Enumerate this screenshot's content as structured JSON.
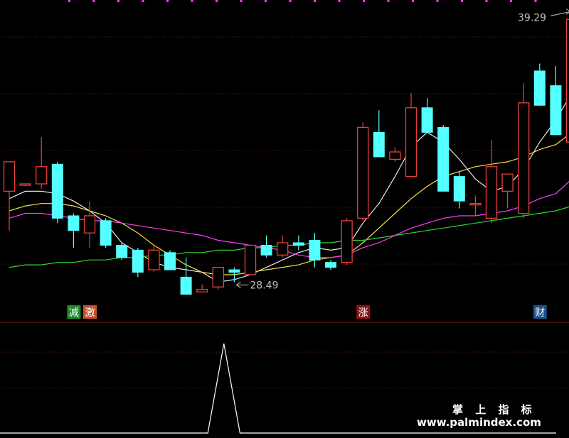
{
  "colors": {
    "background": "#000000",
    "up": "#e8413a",
    "down": "#54ffff",
    "grid": "#7a1a1a",
    "ma5": "#e8e8e8",
    "ma10": "#f2e24a",
    "ma20": "#ff3cff",
    "ma60": "#2ed82e",
    "indicator": "#ffffff",
    "annotation": "#c0c0c0",
    "top_dots": "#ff3cff"
  },
  "chart_data": [
    {
      "type": "candlestick",
      "title": "",
      "xlabel": "",
      "ylabel": "",
      "ylim": [
        27.6,
        39.6
      ],
      "grid": true,
      "candles": [
        {
          "o": 32.1,
          "h": 32.6,
          "l": 30.5,
          "c": 33.3
        },
        {
          "o": 32.4,
          "h": 32.3,
          "l": 32.3,
          "c": 32.4
        },
        {
          "o": 32.4,
          "h": 34.3,
          "l": 32.2,
          "c": 33.1
        },
        {
          "o": 33.2,
          "h": 33.3,
          "l": 30.8,
          "c": 31.0
        },
        {
          "o": 31.1,
          "h": 31.2,
          "l": 29.8,
          "c": 30.5
        },
        {
          "o": 30.4,
          "h": 31.7,
          "l": 29.8,
          "c": 31.1
        },
        {
          "o": 30.9,
          "h": 31.0,
          "l": 29.8,
          "c": 29.9
        },
        {
          "o": 29.9,
          "h": 30.0,
          "l": 29.3,
          "c": 29.4
        },
        {
          "o": 29.7,
          "h": 29.8,
          "l": 28.6,
          "c": 28.8
        },
        {
          "o": 28.9,
          "h": 29.9,
          "l": 28.8,
          "c": 29.7
        },
        {
          "o": 29.6,
          "h": 29.7,
          "l": 28.9,
          "c": 28.9
        },
        {
          "o": 28.6,
          "h": 29.4,
          "l": 28.2,
          "c": 27.9
        },
        {
          "o": 28.0,
          "h": 28.3,
          "l": 28.1,
          "c": 28.1
        },
        {
          "o": 28.2,
          "h": 28.9,
          "l": 28.1,
          "c": 29.0
        },
        {
          "o": 28.9,
          "h": 29.0,
          "l": 28.4,
          "c": 28.8
        },
        {
          "o": 28.7,
          "h": 29.9,
          "l": 28.7,
          "c": 29.9
        },
        {
          "o": 29.9,
          "h": 30.3,
          "l": 29.4,
          "c": 29.5
        },
        {
          "o": 29.5,
          "h": 30.3,
          "l": 29.4,
          "c": 30.0
        },
        {
          "o": 30.0,
          "h": 30.3,
          "l": 29.7,
          "c": 29.9
        },
        {
          "o": 30.1,
          "h": 30.4,
          "l": 29.0,
          "c": 29.3
        },
        {
          "o": 29.2,
          "h": 29.3,
          "l": 28.9,
          "c": 29.0
        },
        {
          "o": 29.2,
          "h": 31.0,
          "l": 29.1,
          "c": 30.9
        },
        {
          "o": 31.0,
          "h": 34.9,
          "l": 30.9,
          "c": 34.7
        },
        {
          "o": 34.5,
          "h": 35.4,
          "l": 33.6,
          "c": 33.5
        },
        {
          "o": 33.4,
          "h": 33.9,
          "l": 33.3,
          "c": 33.7
        },
        {
          "o": 32.7,
          "h": 36.1,
          "l": 32.7,
          "c": 35.5
        },
        {
          "o": 35.5,
          "h": 35.9,
          "l": 34.6,
          "c": 34.5
        },
        {
          "o": 34.7,
          "h": 34.8,
          "l": 32.1,
          "c": 32.1
        },
        {
          "o": 32.7,
          "h": 32.9,
          "l": 31.4,
          "c": 31.7
        },
        {
          "o": 31.6,
          "h": 31.9,
          "l": 31.1,
          "c": 31.6
        },
        {
          "o": 31.0,
          "h": 34.2,
          "l": 30.8,
          "c": 33.1
        },
        {
          "o": 32.1,
          "h": 32.8,
          "l": 31.4,
          "c": 32.8
        },
        {
          "o": 31.2,
          "h": 36.5,
          "l": 31.0,
          "c": 35.7
        },
        {
          "o": 37.0,
          "h": 37.3,
          "l": 36.0,
          "c": 35.6
        },
        {
          "o": 36.4,
          "h": 37.2,
          "l": 35.0,
          "c": 34.4
        },
        {
          "o": 34.1,
          "h": 39.3,
          "l": 33.8,
          "c": 39.1
        }
      ],
      "moving_averages": [
        {
          "name": "MA5",
          "color_key": "ma5",
          "values": [
            31.8,
            32.1,
            32.1,
            32.0,
            31.7,
            31.3,
            30.8,
            30.0,
            29.6,
            29.2,
            29.0,
            28.9,
            28.8,
            28.4,
            28.5,
            28.7,
            29.0,
            29.3,
            29.6,
            29.8,
            29.7,
            29.8,
            30.8,
            31.6,
            32.7,
            33.9,
            34.5,
            34.1,
            33.4,
            32.6,
            32.1,
            32.3,
            33.0,
            34.1,
            35.0,
            36.1
          ]
        },
        {
          "name": "MA10",
          "color_key": "ma10",
          "values": [
            31.3,
            31.5,
            31.6,
            31.6,
            31.5,
            31.3,
            31.1,
            30.8,
            30.4,
            29.9,
            29.5,
            29.1,
            28.8,
            28.7,
            28.7,
            28.8,
            28.9,
            29.0,
            29.1,
            29.3,
            29.4,
            29.5,
            30.0,
            30.6,
            31.2,
            31.8,
            32.3,
            32.7,
            32.9,
            33.1,
            33.2,
            33.3,
            33.5,
            33.8,
            34.0,
            34.5
          ]
        },
        {
          "name": "MA20",
          "color_key": "ma20",
          "values": [
            31.0,
            31.2,
            31.2,
            31.1,
            31.0,
            30.9,
            30.9,
            30.8,
            30.7,
            30.6,
            30.5,
            30.4,
            30.3,
            30.1,
            30.0,
            29.9,
            29.8,
            29.7,
            29.5,
            29.4,
            29.4,
            29.5,
            29.8,
            30.0,
            30.3,
            30.6,
            30.8,
            31.0,
            31.1,
            31.1,
            31.2,
            31.3,
            31.5,
            31.8,
            32.0,
            32.6
          ]
        },
        {
          "name": "MA60",
          "color_key": "ma60",
          "values": [
            29.0,
            29.1,
            29.1,
            29.2,
            29.2,
            29.3,
            29.3,
            29.4,
            29.4,
            29.5,
            29.5,
            29.6,
            29.6,
            29.7,
            29.7,
            29.8,
            29.8,
            29.9,
            29.9,
            30.0,
            30.0,
            30.1,
            30.1,
            30.2,
            30.3,
            30.4,
            30.5,
            30.6,
            30.7,
            30.8,
            30.9,
            31.0,
            31.1,
            31.2,
            31.3,
            31.5
          ]
        }
      ],
      "annotations": {
        "high_label": "39.29",
        "high_index": 35,
        "low_label": "28.49",
        "low_index": 14
      },
      "signals": [
        {
          "text": "减",
          "index": 4,
          "bg": "#1f8a2a",
          "fg": "#ffffff"
        },
        {
          "text": "激",
          "index": 5,
          "bg": "#c4502a",
          "fg": "#ffffff"
        },
        {
          "text": "涨",
          "index": 22,
          "bg": "#8a1414",
          "fg": "#ffffff"
        },
        {
          "text": "财",
          "index": 33,
          "bg": "#1a4f8a",
          "fg": "#ffffff"
        }
      ]
    },
    {
      "type": "line",
      "title": "",
      "xlabel": "",
      "ylabel": "",
      "ylim": [
        0,
        1
      ],
      "x": [
        0,
        12,
        13,
        14,
        35
      ],
      "values": [
        0,
        0,
        1,
        0,
        0
      ]
    }
  ],
  "watermark": {
    "line1": "掌 上 指 标",
    "line2": "www.palmindex.com"
  }
}
